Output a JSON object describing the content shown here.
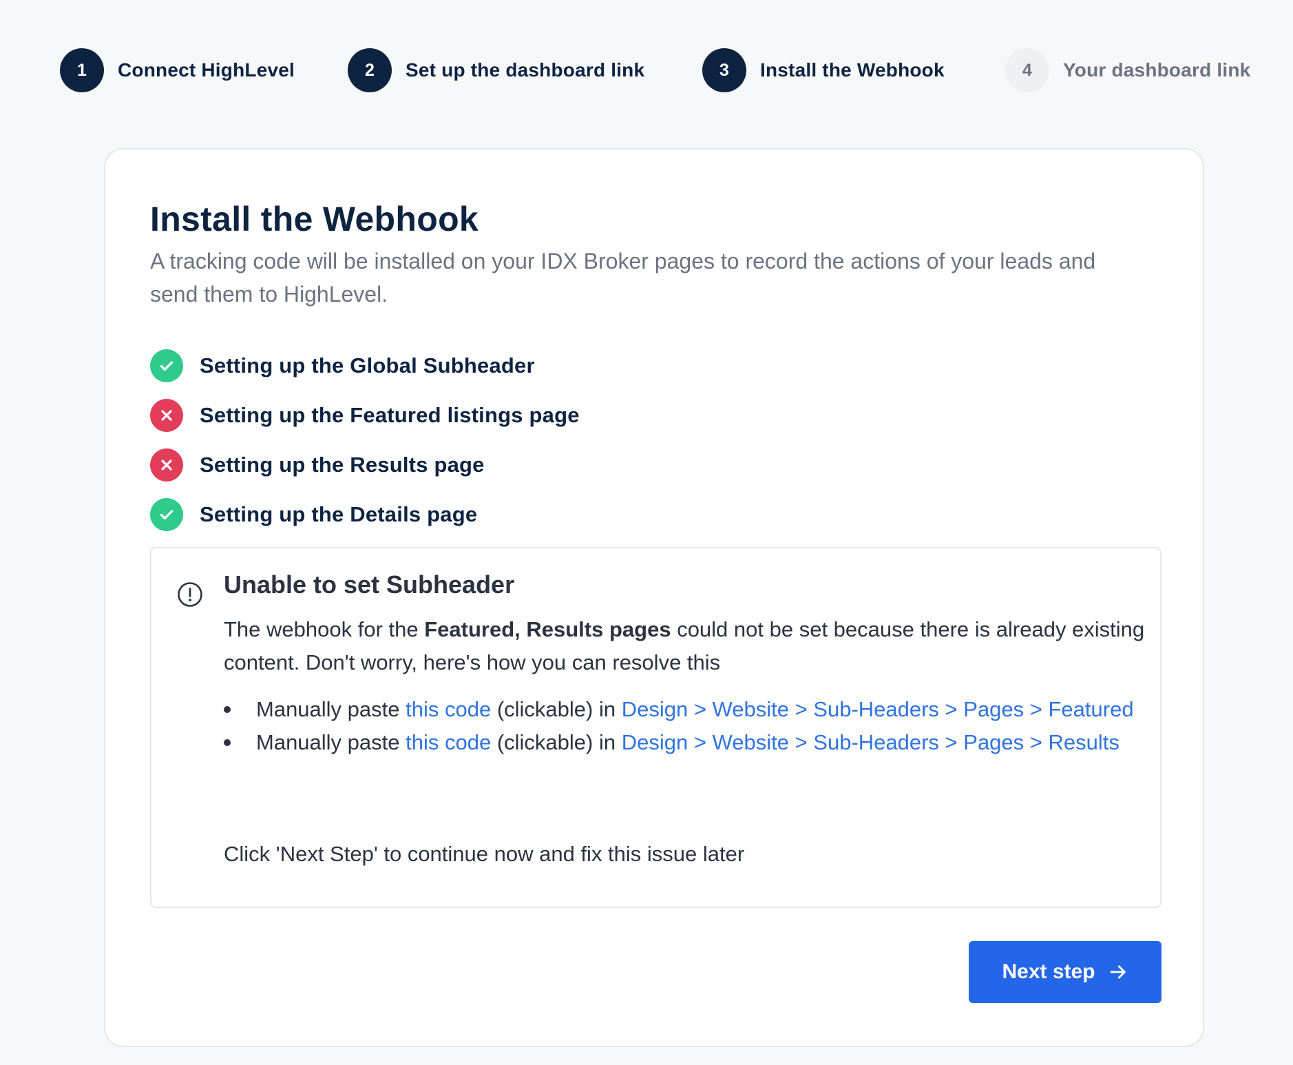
{
  "stepper": {
    "steps": [
      {
        "number": "1",
        "label": "Connect HighLevel",
        "state": "active"
      },
      {
        "number": "2",
        "label": "Set up the dashboard link",
        "state": "active"
      },
      {
        "number": "3",
        "label": "Install the Webhook",
        "state": "active"
      },
      {
        "number": "4",
        "label": "Your dashboard link",
        "state": "inactive"
      }
    ]
  },
  "card": {
    "title": "Install the Webhook",
    "description": "A tracking code will be installed on your IDX Broker pages to record the actions of your leads and send them to HighLevel.",
    "checklist": [
      {
        "label": "Setting up the Global Subheader",
        "status": "success",
        "icon": "check-circle-icon"
      },
      {
        "label": "Setting up the Featured listings page",
        "status": "error",
        "icon": "x-circle-icon"
      },
      {
        "label": "Setting up the Results page",
        "status": "error",
        "icon": "x-circle-icon"
      },
      {
        "label": "Setting up the Details page",
        "status": "success",
        "icon": "check-circle-icon"
      }
    ]
  },
  "alert": {
    "icon": "info-circle-icon",
    "title": "Unable to set Subheader",
    "body_prefix": "The webhook for the ",
    "body_bold": "Featured, Results pages",
    "body_suffix": " could not be set because there is already existing content. Don't worry, here's how you can resolve this",
    "items": [
      {
        "prefix": "Manually paste ",
        "link_text": "this code",
        "middle": " (clickable) in ",
        "path": "Design > Website > Sub-Headers > Pages > Featured"
      },
      {
        "prefix": "Manually paste ",
        "link_text": "this code",
        "middle": " (clickable) in ",
        "path": "Design > Website > Sub-Headers > Pages > Results"
      }
    ],
    "footer": "Click 'Next Step' to continue now and fix this issue later"
  },
  "actions": {
    "next_label": "Next step",
    "next_icon": "arrow-right-icon"
  },
  "colors": {
    "primary_dark": "#0d2340",
    "success": "#2ecb8d",
    "error": "#e23d5a",
    "link": "#2f74e0",
    "button": "#2466e8"
  }
}
